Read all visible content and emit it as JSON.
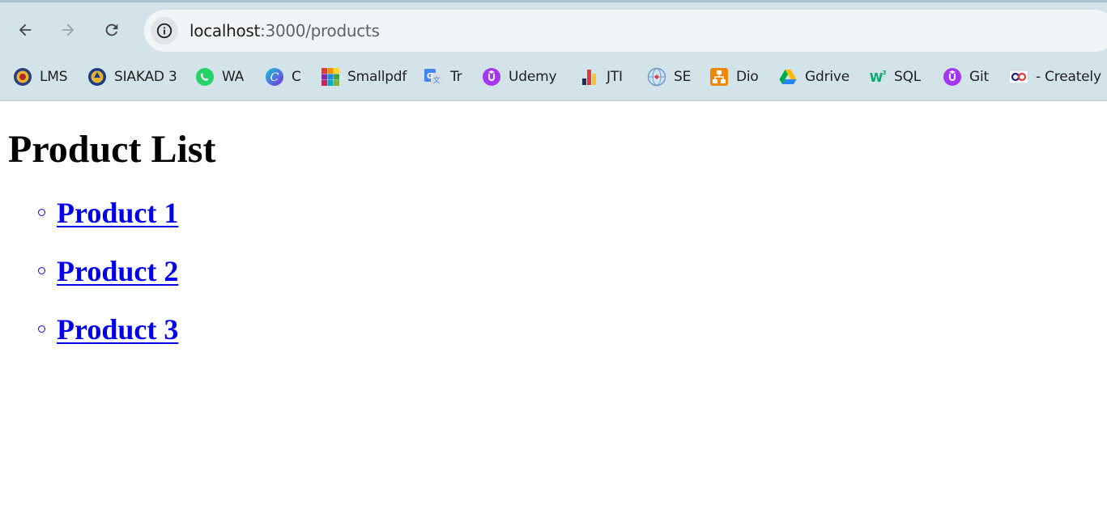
{
  "browser": {
    "url_host": "localhost",
    "url_path": ":3000/products",
    "bookmarks": [
      {
        "label": "LMS",
        "icon": "lms-emblem-icon"
      },
      {
        "label": "SIAKAD 3",
        "icon": "siakad-emblem-icon"
      },
      {
        "label": "WA",
        "icon": "whatsapp-icon"
      },
      {
        "label": "C",
        "icon": "canva-icon"
      },
      {
        "label": "Smallpdf",
        "icon": "smallpdf-icon"
      },
      {
        "label": "Tr",
        "icon": "google-translate-icon"
      },
      {
        "label": "Udemy",
        "icon": "udemy-icon"
      },
      {
        "label": "JTI",
        "icon": "jti-icon"
      },
      {
        "label": "SE",
        "icon": "se-globe-icon"
      },
      {
        "label": "Dio",
        "icon": "diagrams-icon"
      },
      {
        "label": "Gdrive",
        "icon": "google-drive-icon"
      },
      {
        "label": "SQL",
        "icon": "w3schools-icon"
      },
      {
        "label": "Git",
        "icon": "udemy-icon"
      },
      {
        "label": "- Creately",
        "icon": "creately-icon"
      }
    ]
  },
  "page": {
    "title": "Product List",
    "products": [
      {
        "label": "Product 1"
      },
      {
        "label": "Product 2"
      },
      {
        "label": "Product 3"
      }
    ]
  },
  "colors": {
    "link": "#0000ee",
    "chrome_background": "#d3e3ea",
    "omnibox_background": "#f1f5f7"
  }
}
